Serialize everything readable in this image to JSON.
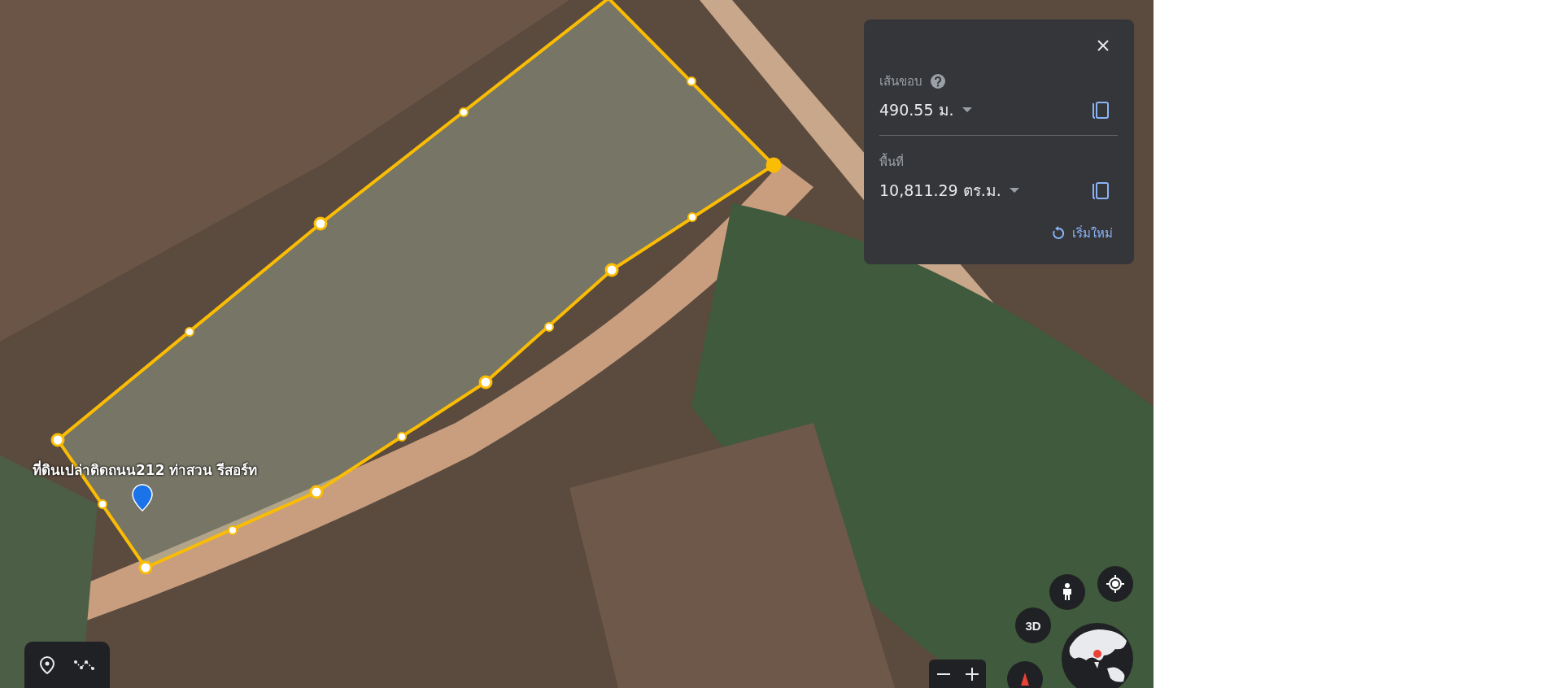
{
  "map": {
    "place_label": "ที่ดินเปล่าติดถนน212 ท่าสวน รีสอร์ท",
    "view_button": "3D"
  },
  "measure_panel": {
    "perimeter": {
      "label": "เส้นขอบ",
      "value": "490.55 ม."
    },
    "area": {
      "label": "พื้นที่",
      "value": "10,811.29 ตร.ม."
    },
    "reset": "เริ่มใหม่"
  }
}
